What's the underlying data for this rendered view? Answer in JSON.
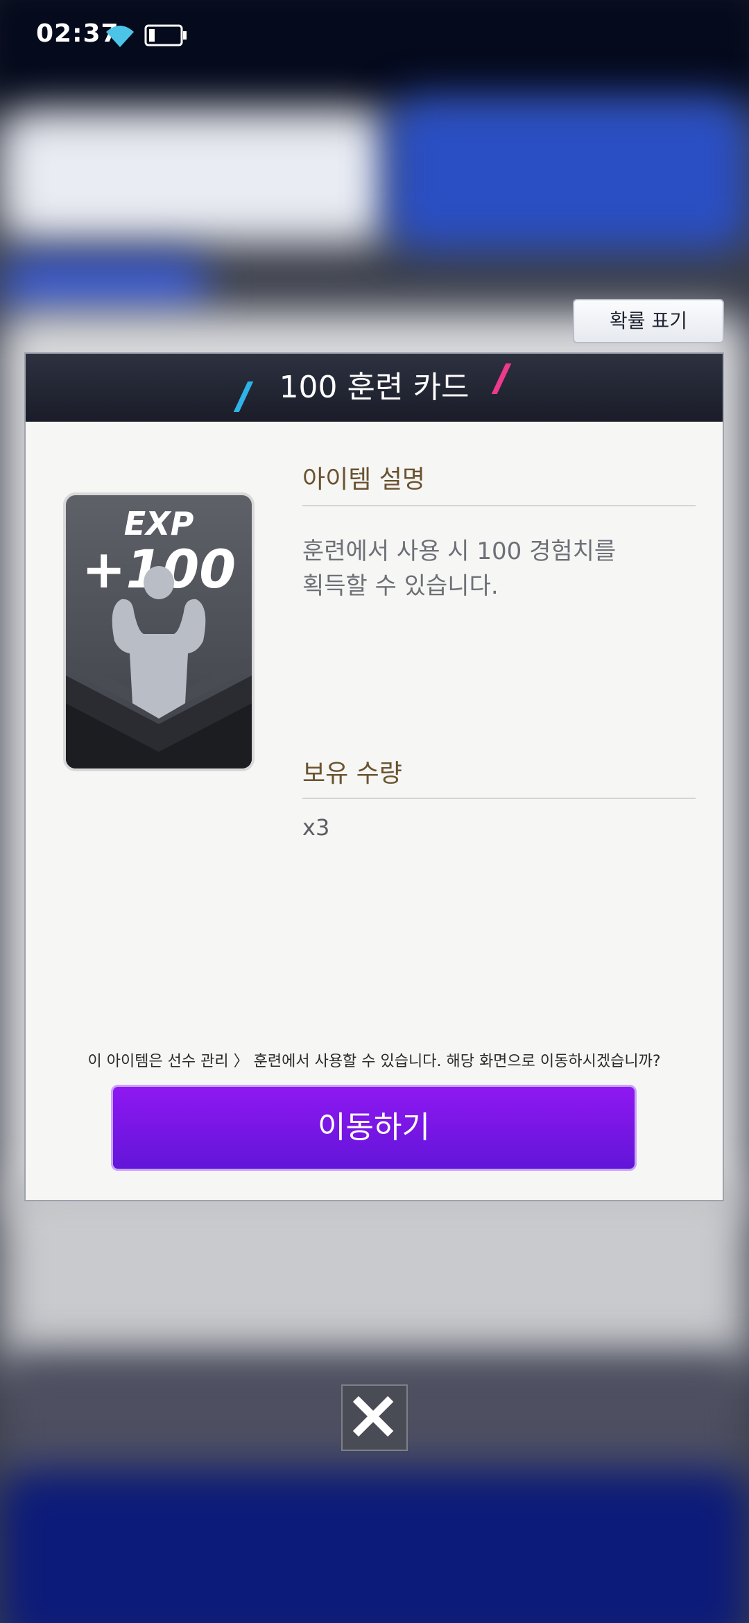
{
  "status_bar": {
    "time": "02:37"
  },
  "probability_button": {
    "label": "확률 표기"
  },
  "dialog": {
    "title": "100 훈련 카드",
    "card": {
      "exp_label": "EXP",
      "amount_label": "+100"
    },
    "description_label": "아이템 설명",
    "description_text": "훈련에서 사용 시 100 경험치를\n획득할 수 있습니다.",
    "quantity_label": "보유 수량",
    "quantity_value": "x3",
    "note": "이 아이템은 선수 관리 〉 훈련에서 사용할 수 있습니다. 해당 화면으로 이동하시겠습니까?",
    "move_button_label": "이동하기"
  },
  "colors": {
    "header_bg": "#1f2230",
    "button_purple": "#7a16e6",
    "label_brown": "#6b5330",
    "accent_blue": "#2fb2e8",
    "accent_pink": "#ee3a8c"
  },
  "icons": [
    "wifi-icon",
    "battery-icon",
    "close-icon"
  ]
}
